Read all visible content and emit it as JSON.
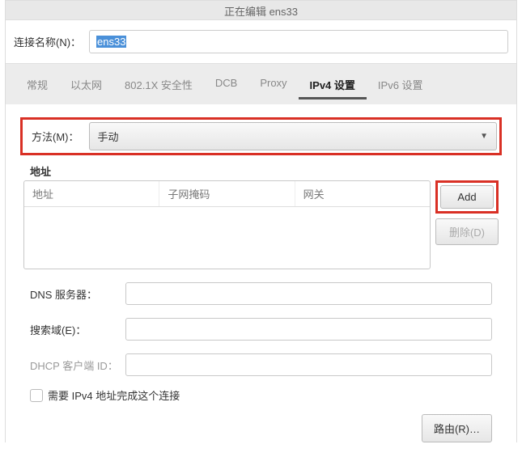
{
  "titlebar": "正在编辑 ens33",
  "connection_name_label": "连接名称(N)：",
  "connection_name_value": "ens33",
  "tabs": [
    {
      "label": "常规"
    },
    {
      "label": "以太网"
    },
    {
      "label": "802.1X 安全性"
    },
    {
      "label": "DCB"
    },
    {
      "label": "Proxy"
    },
    {
      "label": "IPv4 设置",
      "active": true
    },
    {
      "label": "IPv6 设置"
    }
  ],
  "method": {
    "label": "方法(M)：",
    "value": "手动"
  },
  "addresses": {
    "section_label": "地址",
    "headers": [
      "地址",
      "子网掩码",
      "网关"
    ],
    "add_btn": "Add",
    "delete_btn": "删除(D)"
  },
  "dns": {
    "label": "DNS 服务器：",
    "value": ""
  },
  "search_domain": {
    "label": "搜索域(E)：",
    "value": ""
  },
  "dhcp_client": {
    "label": "DHCP 客户端 ID：",
    "value": ""
  },
  "require_checkbox": "需要 IPv4 地址完成这个连接",
  "routes_btn": "路由(R)…"
}
